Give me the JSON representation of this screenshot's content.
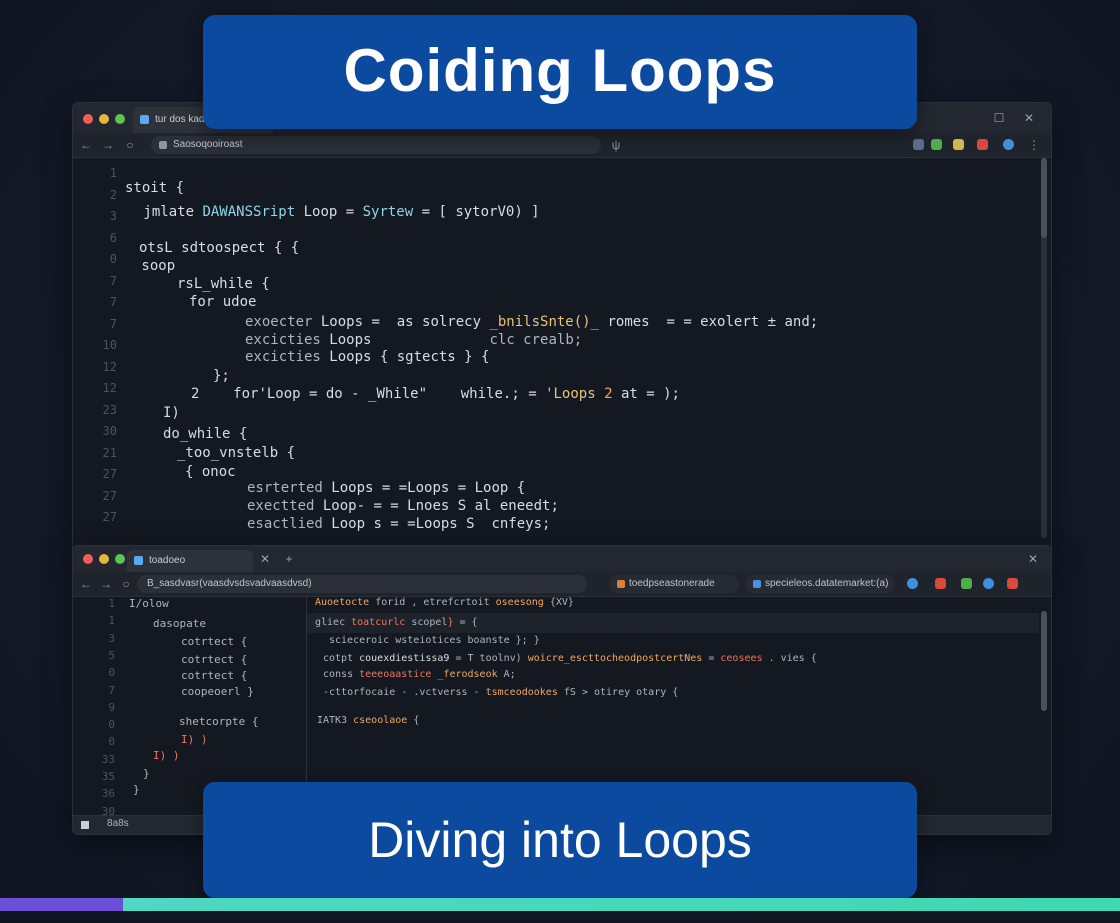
{
  "banner_top": {
    "title": "Coiding Loops"
  },
  "banner_bottom": {
    "title": "Diving into Loops"
  },
  "colors": {
    "banner": "#0c4aa0",
    "accent_purple": "#6a4fd8",
    "accent_teal": "#3fd8b0",
    "background": "#131a27"
  },
  "window_top": {
    "tab": {
      "label": "tur dos kadelo"
    },
    "address": "Saosoqooiroast",
    "line_numbers": [
      "1",
      "2",
      "3",
      "6",
      "0",
      "7",
      "7",
      "7",
      "10",
      "12",
      "12",
      "23",
      "30",
      "21",
      "27",
      "27",
      "27"
    ],
    "code": [
      [
        {
          "t": "stoit {",
          "c": "k-def"
        }
      ],
      [
        {
          "t": " jmlate ",
          "c": "k-def"
        },
        {
          "t": "DAWANSSript",
          "c": "k-fn"
        },
        {
          "t": " Loop = ",
          "c": "k-def"
        },
        {
          "t": "Syrtew",
          "c": "k-fn"
        },
        {
          "t": " = [ sytorV0) ]",
          "c": "k-def"
        }
      ],
      [
        {
          "t": "otsL sdtoospect { {",
          "c": "k-def"
        }
      ],
      [
        {
          "t": " soop",
          "c": "k-def"
        }
      ],
      [
        {
          "t": "rsL_while {",
          "c": "k-def"
        }
      ],
      [
        {
          "t": "for udoe",
          "c": "k-def"
        }
      ],
      [
        {
          "t": "exoecter ",
          "c": "k-dim"
        },
        {
          "t": "Loops",
          "c": "k-def"
        },
        {
          "t": " =  as solrecy ",
          "c": "k-def"
        },
        {
          "t": "_bnilsSnte()_",
          "c": "k-str"
        },
        {
          "t": " romes  = = exolert ± and;",
          "c": "k-def"
        }
      ],
      [
        {
          "t": "excicties ",
          "c": "k-dim"
        },
        {
          "t": "Loops",
          "c": "k-def"
        },
        {
          "t": "              clc crealb;",
          "c": "k-dim"
        }
      ],
      [
        {
          "t": "excicties ",
          "c": "k-dim"
        },
        {
          "t": "Loops",
          "c": "k-def"
        },
        {
          "t": " { sgtects } {",
          "c": "k-def"
        }
      ],
      [
        {
          "t": "};",
          "c": "k-def"
        }
      ],
      [
        {
          "t": "2    ",
          "c": "k-def"
        },
        {
          "t": "for'Loop",
          "c": "k-def"
        },
        {
          "t": " = do - _While\"    ",
          "c": "k-def"
        },
        {
          "t": "while.;",
          "c": "k-def"
        },
        {
          "t": " = ",
          "c": "k-def"
        },
        {
          "t": "'Loops ",
          "c": "k-str"
        },
        {
          "t": "2",
          "c": "k-org"
        },
        {
          "t": " at = );",
          "c": "k-def"
        }
      ],
      [
        {
          "t": "I)",
          "c": "k-def"
        }
      ],
      [
        {
          "t": "do_while {",
          "c": "k-def"
        }
      ],
      [
        {
          "t": "_too_vnstelb {",
          "c": "k-def"
        }
      ],
      [
        {
          "t": "{ onoc",
          "c": "k-def"
        }
      ],
      [
        {
          "t": "esrterted ",
          "c": "k-dim"
        },
        {
          "t": "Loops",
          "c": "k-def"
        },
        {
          "t": " = =Loops",
          "c": "k-def"
        },
        {
          "t": " = ",
          "c": "k-def"
        },
        {
          "t": "Loop",
          "c": "k-def"
        },
        {
          "t": " {",
          "c": "k-def"
        }
      ],
      [
        {
          "t": "exectted ",
          "c": "k-dim"
        },
        {
          "t": "Loop-",
          "c": "k-def"
        },
        {
          "t": " = = Lnoes S ",
          "c": "k-def"
        },
        {
          "t": "al",
          "c": "k-def"
        },
        {
          "t": " eneedt;",
          "c": "k-def"
        }
      ],
      [
        {
          "t": "esactlied ",
          "c": "k-dim"
        },
        {
          "t": "Loop s",
          "c": "k-def"
        },
        {
          "t": " = =Loops",
          "c": "k-def"
        },
        {
          "t": " S  ",
          "c": "k-def"
        },
        {
          "t": "cnfeys;",
          "c": "k-def"
        }
      ]
    ]
  },
  "window_bottom": {
    "tab": {
      "label": "toadoeo"
    },
    "address": "B_sasdvasr(vaasdvsdsvadvaasdvsd)",
    "tab2": {
      "label": "toedpseastonerade"
    },
    "tab3": {
      "label": "specieleos.datatemarket:(a)"
    },
    "status": "8a8s",
    "left_line_numbers": [
      "1",
      "1",
      "3",
      "5",
      "0",
      "7",
      "9",
      "0",
      "0",
      "33",
      "35",
      "36",
      "30",
      "38"
    ],
    "left_code": [
      [
        {
          "t": "I/olow",
          "c": "k-dim"
        }
      ],
      [
        {
          "t": "dasopate",
          "c": "k-dim"
        }
      ],
      [
        {
          "t": "cotrtect {",
          "c": "k-dim"
        }
      ],
      [
        {
          "t": "cotrtect {",
          "c": "k-dim"
        }
      ],
      [
        {
          "t": "cotrtect {",
          "c": "k-dim"
        }
      ],
      [
        {
          "t": "coopeoerl }",
          "c": "k-dim"
        }
      ],
      [
        {
          "t": "shetcorpte {",
          "c": "k-dim"
        }
      ],
      [
        {
          "t": "I) )",
          "c": "k-red"
        }
      ],
      [
        {
          "t": "I) )",
          "c": "k-red"
        }
      ],
      [
        {
          "t": "}",
          "c": "k-dim"
        }
      ],
      [
        {
          "t": "}",
          "c": "k-dim"
        }
      ]
    ],
    "right_code": [
      [
        {
          "t": "Auoetocte ",
          "c": "k-org"
        },
        {
          "t": "forid ",
          "c": "k-dim"
        },
        {
          "t": ", ",
          "c": "k-dim"
        },
        {
          "t": "etrefcrtoit ",
          "c": "k-dim"
        },
        {
          "t": "oseesong ",
          "c": "k-org"
        },
        {
          "t": "{XV}",
          "c": "k-dim"
        }
      ],
      [
        {
          "t": "gliec ",
          "c": "k-dim"
        },
        {
          "t": "toatcurlc",
          "c": "k-red"
        },
        {
          "t": " scopel",
          "c": "k-dim"
        },
        {
          "t": "}",
          "c": "k-red"
        },
        {
          "t": " = {",
          "c": "k-dim"
        }
      ],
      [
        {
          "t": "scieceroic ",
          "c": "k-dim"
        },
        {
          "t": "wsteiotices ",
          "c": "k-dim"
        },
        {
          "t": "boanste ",
          "c": "k-dim"
        },
        {
          "t": "}; }",
          "c": "k-dim"
        }
      ],
      [
        {
          "t": "cotpt ",
          "c": "k-dim"
        },
        {
          "t": "couexdiestissa9",
          "c": "k-def"
        },
        {
          "t": " = T ",
          "c": "k-dim"
        },
        {
          "t": "toolnv) ",
          "c": "k-dim"
        },
        {
          "t": "woicre_escttocheodpostcertNes",
          "c": "k-org"
        },
        {
          "t": " = ",
          "c": "k-dim"
        },
        {
          "t": "ceosees",
          "c": "k-red"
        },
        {
          "t": " . vies {",
          "c": "k-dim"
        }
      ],
      [
        {
          "t": "conss ",
          "c": "k-dim"
        },
        {
          "t": "teeeoaastice",
          "c": "k-red"
        },
        {
          "t": " _",
          "c": "k-dim"
        },
        {
          "t": "ferodseok ",
          "c": "k-org"
        },
        {
          "t": "A;",
          "c": "k-dim"
        }
      ],
      [
        {
          "t": "-cttorfocaie ",
          "c": "k-dim"
        },
        {
          "t": "- ",
          "c": "k-dim"
        },
        {
          "t": ".vctverss ",
          "c": "k-dim"
        },
        {
          "t": "- ",
          "c": "k-dim"
        },
        {
          "t": "tsmceodookes ",
          "c": "k-org"
        },
        {
          "t": "fS ",
          "c": "k-dim"
        },
        {
          "t": "> ",
          "c": "k-dim"
        },
        {
          "t": "otirey ",
          "c": "k-dim"
        },
        {
          "t": "otary {",
          "c": "k-dim"
        }
      ],
      [
        {
          "t": "",
          "c": "k-dim"
        }
      ],
      [
        {
          "t": "IATK3 ",
          "c": "k-dim"
        },
        {
          "t": "cseoolaoe ",
          "c": "k-org"
        },
        {
          "t": "{",
          "c": "k-dim"
        }
      ]
    ]
  }
}
